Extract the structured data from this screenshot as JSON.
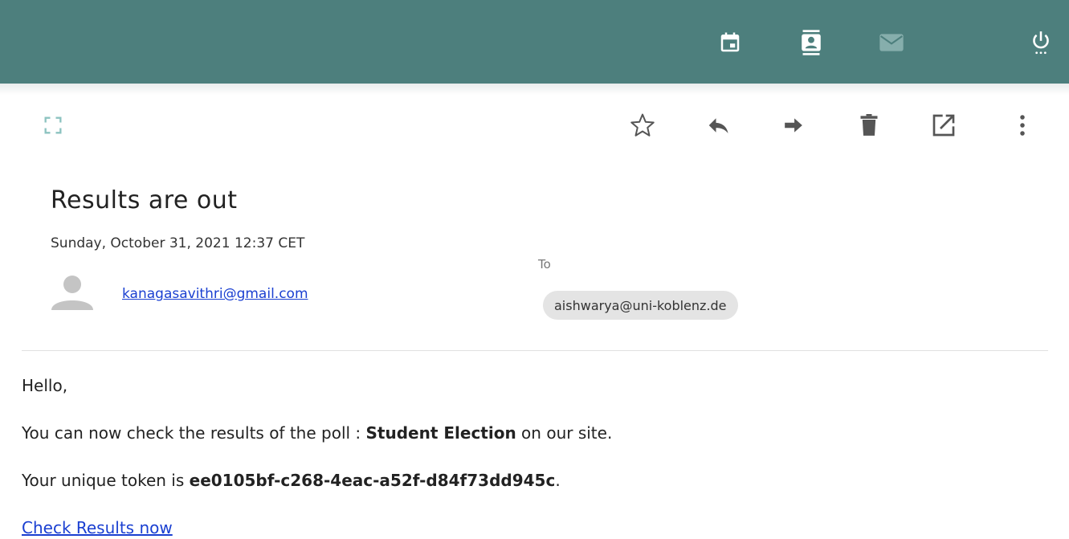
{
  "email": {
    "subject": "Results are out",
    "date": "Sunday, October 31, 2021 12:37 CET",
    "sender": "kanagasavithri@gmail.com",
    "to_label": "To",
    "recipient": "aishwarya@uni-koblenz.de"
  },
  "body": {
    "greeting": "Hello,",
    "line1_prefix": "You can now check the results of the poll : ",
    "line1_bold": "Student Election",
    "line1_suffix": " on our site.",
    "line2_prefix": "Your unique token is ",
    "line2_bold": "ee0105bf-c268-4eac-a52f-d84f73dd945c",
    "line2_suffix": ".",
    "link_text": "Check Results now"
  },
  "icons": {
    "topbar": [
      "calendar-icon",
      "contacts-icon",
      "mail-icon",
      "power-icon"
    ],
    "toolbar": [
      "fullscreen-icon",
      "star-icon",
      "reply-icon",
      "forward-icon",
      "delete-icon",
      "open-external-icon",
      "more-options-icon"
    ]
  },
  "colors": {
    "topbar": "#4d7f7d",
    "link": "#1a3fd1",
    "mail_icon_inactive": "#86aeac"
  }
}
